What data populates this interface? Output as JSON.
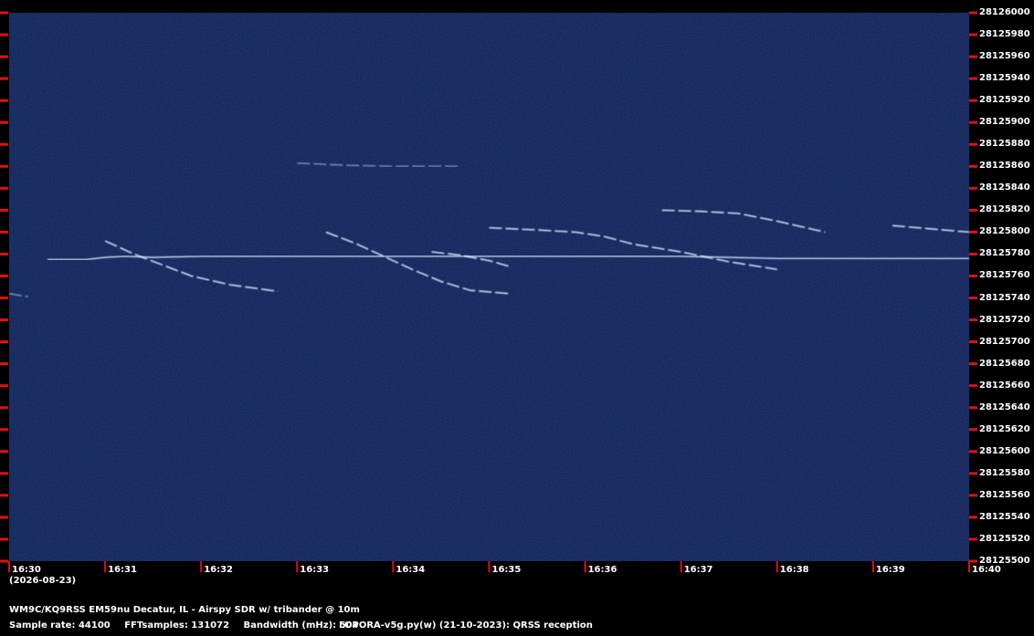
{
  "colors": {
    "background": "#000000",
    "waterfall": "#0b1a4a",
    "tick": "#e01010",
    "signal": "#cfe6ff"
  },
  "chart_data": {
    "type": "heatmap",
    "title": "",
    "ylim": [
      28125500,
      28126000
    ],
    "y_ticks": [
      "28126000",
      "28125980",
      "28125960",
      "28125940",
      "28125920",
      "28125900",
      "28125880",
      "28125860",
      "28125840",
      "28125820",
      "28125800",
      "28125780",
      "28125760",
      "28125740",
      "28125720",
      "28125700",
      "28125680",
      "28125660",
      "28125640",
      "28125620",
      "28125600",
      "28125580",
      "28125560",
      "28125540",
      "28125520",
      "28125500"
    ],
    "x_ticks": [
      "16:30",
      "16:31",
      "16:32",
      "16:33",
      "16:34",
      "16:35",
      "16:36",
      "16:37",
      "16:38",
      "16:39",
      "16:40"
    ],
    "date": "(2026-08-23)",
    "series": [
      {
        "points": [
          [
            0.4,
            28125775
          ],
          [
            0.8,
            28125775
          ],
          [
            1.0,
            28125777
          ],
          [
            1.2,
            28125778
          ],
          [
            1.5,
            28125777
          ],
          [
            2.0,
            28125778
          ],
          [
            2.5,
            28125778
          ],
          [
            3.0,
            28125778
          ],
          [
            3.5,
            28125778
          ],
          [
            4.0,
            28125778
          ],
          [
            4.5,
            28125778
          ],
          [
            5.0,
            28125778
          ],
          [
            5.5,
            28125778
          ],
          [
            6.0,
            28125778
          ],
          [
            6.5,
            28125778
          ],
          [
            7.0,
            28125778
          ],
          [
            7.5,
            28125777
          ],
          [
            8.0,
            28125776
          ],
          [
            8.5,
            28125776
          ],
          [
            9.0,
            28125776
          ],
          [
            9.5,
            28125776
          ],
          [
            10.0,
            28125776
          ]
        ]
      },
      {
        "points": [
          [
            1.0,
            28125792
          ],
          [
            1.3,
            28125780
          ],
          [
            1.6,
            28125770
          ],
          [
            1.9,
            28125760
          ],
          [
            2.3,
            28125752
          ],
          [
            2.8,
            28125746
          ]
        ]
      },
      {
        "points": [
          [
            3.3,
            28125800
          ],
          [
            3.6,
            28125790
          ],
          [
            3.9,
            28125778
          ],
          [
            4.2,
            28125766
          ],
          [
            4.5,
            28125755
          ],
          [
            4.8,
            28125747
          ],
          [
            5.2,
            28125744
          ]
        ]
      },
      {
        "points": [
          [
            4.4,
            28125782
          ],
          [
            4.7,
            28125779
          ],
          [
            5.0,
            28125774
          ],
          [
            5.2,
            28125769
          ]
        ]
      },
      {
        "points": [
          [
            5.0,
            28125804
          ],
          [
            5.5,
            28125802
          ],
          [
            5.9,
            28125800
          ],
          [
            6.2,
            28125796
          ],
          [
            6.5,
            28125789
          ],
          [
            7.0,
            28125782
          ],
          [
            7.5,
            28125773
          ],
          [
            8.0,
            28125766
          ]
        ]
      },
      {
        "points": [
          [
            6.8,
            28125820
          ],
          [
            7.2,
            28125819
          ],
          [
            7.6,
            28125817
          ],
          [
            8.0,
            28125810
          ],
          [
            8.5,
            28125800
          ]
        ]
      },
      {
        "points": [
          [
            9.2,
            28125806
          ],
          [
            9.6,
            28125803
          ],
          [
            10.0,
            28125800
          ]
        ]
      },
      {
        "points": [
          [
            0.0,
            28125744
          ],
          [
            0.2,
            28125741
          ]
        ]
      },
      {
        "points": [
          [
            3.0,
            28125863
          ],
          [
            3.5,
            28125861
          ],
          [
            4.0,
            28125860
          ],
          [
            4.7,
            28125860
          ]
        ]
      }
    ]
  },
  "info": {
    "line1": "WM9C/KQ9RSS EM59nu Decatur, IL - Airspy SDR w/ tribander @ 10m",
    "sample_rate": "Sample rate: 44100",
    "fft": "FFTsamples: 131072",
    "bandwidth": "Bandwidth (mHz): 504",
    "program": "LOPORA-v5g.py(w) (21-10-2023): QRSS reception"
  }
}
